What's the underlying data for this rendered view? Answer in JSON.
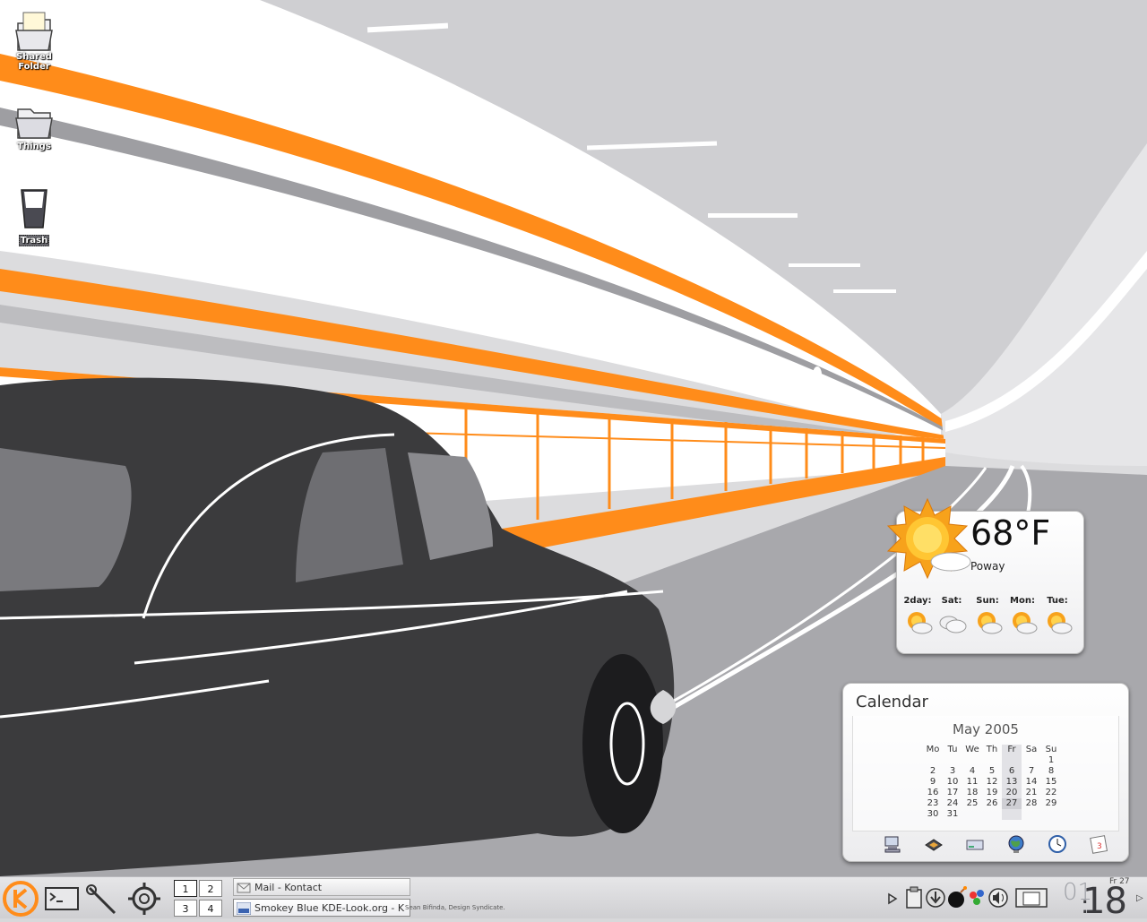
{
  "desktop": {
    "icons": [
      {
        "label_line1": "Shared",
        "label_line2": "Folder"
      },
      {
        "label": "Things"
      },
      {
        "label": "Trash"
      }
    ]
  },
  "weather": {
    "temperature": "68°F",
    "city": "Poway",
    "forecast": [
      {
        "day": "2day:",
        "icon": "partly-cloudy-icon"
      },
      {
        "day": "Sat:",
        "icon": "cloudy-icon"
      },
      {
        "day": "Sun:",
        "icon": "partly-cloudy-icon"
      },
      {
        "day": "Mon:",
        "icon": "partly-cloudy-icon"
      },
      {
        "day": "Tue:",
        "icon": "partly-cloudy-icon"
      }
    ]
  },
  "calendar": {
    "title": "Calendar",
    "month": "May 2005",
    "weekdays": [
      "Mo",
      "Tu",
      "We",
      "Th",
      "Fr",
      "Sa",
      "Su"
    ],
    "weeks": [
      [
        "",
        "",
        "",
        "",
        "",
        "",
        "1"
      ],
      [
        "2",
        "3",
        "4",
        "5",
        "6",
        "7",
        "8"
      ],
      [
        "9",
        "10",
        "11",
        "12",
        "13",
        "14",
        "15"
      ],
      [
        "16",
        "17",
        "18",
        "19",
        "20",
        "21",
        "22"
      ],
      [
        "23",
        "24",
        "25",
        "26",
        "27",
        "28",
        "29"
      ],
      [
        "30",
        "31",
        "",
        "",
        "",
        "",
        ""
      ]
    ],
    "today": "27",
    "apps": [
      "computer-icon",
      "chip-icon",
      "drive-icon",
      "globe-icon",
      "clock-icon",
      "calendar-icon"
    ]
  },
  "taskbar": {
    "pager": [
      "1",
      "2",
      "3",
      "4"
    ],
    "tasks": [
      {
        "label": "Mail - Kontact"
      },
      {
        "label": "Smokey Blue KDE-Look.org - K"
      }
    ],
    "credit": "Sean Bifinda, Design Syndicate.",
    "clock": {
      "hour": "01",
      "minute": "18",
      "date": "Fr 27"
    }
  },
  "colors": {
    "accent": "#ff8c1a",
    "car": "#3b3b3d",
    "tunnel_grey": "#9e9ea2"
  }
}
